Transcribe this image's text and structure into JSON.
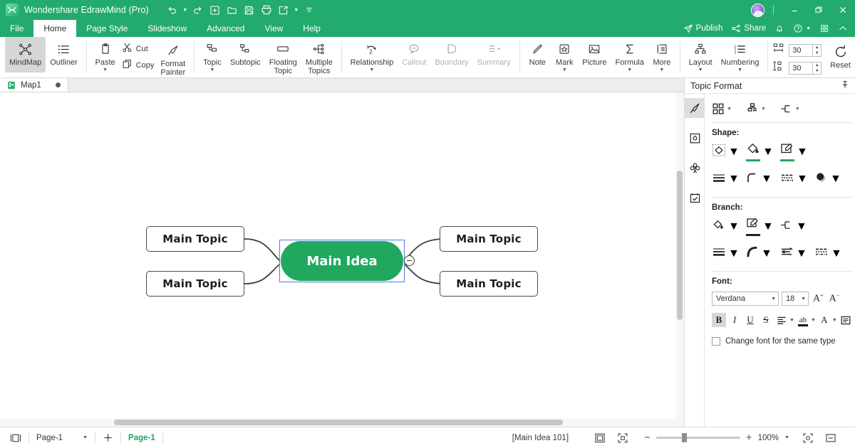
{
  "titlebar": {
    "app_name": "Wondershare EdrawMind (Pro)",
    "logo_glyph": "M",
    "quick_access": [
      {
        "name": "undo-icon",
        "label": "Undo",
        "caret": true
      },
      {
        "name": "redo-icon",
        "label": "Redo",
        "caret": false
      },
      {
        "name": "new-icon",
        "label": "New",
        "caret": false
      },
      {
        "name": "open-folder-icon",
        "label": "Open",
        "caret": false
      },
      {
        "name": "save-icon",
        "label": "Save",
        "caret": false
      },
      {
        "name": "print-icon",
        "label": "Print",
        "caret": false
      },
      {
        "name": "export-icon",
        "label": "Export",
        "caret": true
      },
      {
        "name": "more-quick-access-icon",
        "label": "More",
        "caret": false
      }
    ],
    "window_controls": [
      "minimize",
      "restore",
      "close"
    ]
  },
  "menubar": {
    "items": [
      {
        "label": "File",
        "active": false
      },
      {
        "label": "Home",
        "active": true
      },
      {
        "label": "Page Style",
        "active": false
      },
      {
        "label": "Slideshow",
        "active": false
      },
      {
        "label": "Advanced",
        "active": false
      },
      {
        "label": "View",
        "active": false
      },
      {
        "label": "Help",
        "active": false
      }
    ],
    "right": {
      "publish": "Publish",
      "share": "Share",
      "bell_icon": "notification-bell-icon",
      "help_icon": "help-circle-icon",
      "apps_icon": "apps-grid-icon",
      "collapse_icon": "collapse-ribbon-icon"
    }
  },
  "ribbon": {
    "view_group": [
      {
        "label": "MindMap",
        "icon": "mindmap-icon",
        "selected": true,
        "disabled": false
      },
      {
        "label": "Outliner",
        "icon": "outliner-icon",
        "selected": false,
        "disabled": false
      }
    ],
    "clipboard": {
      "paste": "Paste",
      "cut": "Cut",
      "copy": "Copy",
      "format_painter": "Format\nPainter"
    },
    "topic_group": [
      {
        "label": "Topic",
        "icon": "topic-icon",
        "caret": true
      },
      {
        "label": "Subtopic",
        "icon": "subtopic-icon",
        "caret": false
      },
      {
        "label": "Floating\nTopic",
        "icon": "floating-topic-icon",
        "caret": false
      },
      {
        "label": "Multiple\nTopics",
        "icon": "multiple-topics-icon",
        "caret": false
      }
    ],
    "relation_group": [
      {
        "label": "Relationship",
        "icon": "relationship-icon",
        "caret": true,
        "disabled": false
      },
      {
        "label": "Callout",
        "icon": "callout-icon",
        "caret": false,
        "disabled": true
      },
      {
        "label": "Boundary",
        "icon": "boundary-icon",
        "caret": false,
        "disabled": true
      },
      {
        "label": "Summary",
        "icon": "summary-icon",
        "caret": false,
        "disabled": true
      }
    ],
    "insert_group": [
      {
        "label": "Note",
        "icon": "note-icon",
        "caret": false
      },
      {
        "label": "Mark",
        "icon": "mark-icon",
        "caret": true
      },
      {
        "label": "Picture",
        "icon": "picture-icon",
        "caret": false
      },
      {
        "label": "Formula",
        "icon": "formula-icon",
        "caret": true
      },
      {
        "label": "More",
        "icon": "more-insert-icon",
        "caret": true
      }
    ],
    "layout_group": [
      {
        "label": "Layout",
        "icon": "layout-icon",
        "caret": true
      },
      {
        "label": "Numbering",
        "icon": "numbering-icon",
        "caret": true
      }
    ],
    "spacing": {
      "horizontal_icon": "horizontal-spacing-icon",
      "horizontal_value": "30",
      "vertical_icon": "vertical-spacing-icon",
      "vertical_value": "30",
      "reset_label": "Reset",
      "reset_icon": "reset-icon"
    }
  },
  "doc_tabs": [
    {
      "label": "Map1",
      "icon": "document-icon",
      "modified": true
    }
  ],
  "canvas": {
    "center_topic": "Main Idea",
    "branches": [
      {
        "label": "Main Topic",
        "position": "top-left"
      },
      {
        "label": "Main Topic",
        "position": "bottom-left"
      },
      {
        "label": "Main Topic",
        "position": "top-right"
      },
      {
        "label": "Main Topic",
        "position": "bottom-right"
      }
    ],
    "collapse_icon": "collapse-node-icon",
    "center_fill": "#21a85f",
    "selection_color": "#4a7fe0"
  },
  "right_panel": {
    "title": "Topic Format",
    "pin_icon": "pin-icon",
    "tabs": [
      {
        "name": "style-tab",
        "icon": "paint-brush-icon",
        "active": true
      },
      {
        "name": "image-tab",
        "icon": "image-frame-icon",
        "active": false
      },
      {
        "name": "clipart-tab",
        "icon": "clover-icon",
        "active": false
      },
      {
        "name": "task-tab",
        "icon": "task-checklist-icon",
        "active": false
      }
    ],
    "top_tools": [
      {
        "name": "theme-icon",
        "caret": true
      },
      {
        "name": "layout-structure-icon",
        "caret": true
      },
      {
        "name": "branch-style-icon",
        "caret": true
      }
    ],
    "shape": {
      "label": "Shape:",
      "tools": [
        {
          "name": "shape-select-icon",
          "caret": true,
          "accent": false
        },
        {
          "name": "fill-color-icon",
          "caret": true,
          "accent": true
        },
        {
          "name": "shape-outline-icon",
          "caret": true,
          "accent": true
        },
        {
          "name": "line-weight-icon",
          "caret": true,
          "accent": false
        },
        {
          "name": "corner-style-icon",
          "caret": true,
          "accent": false
        },
        {
          "name": "line-dash-icon",
          "caret": true,
          "accent": false
        },
        {
          "name": "shadow-icon",
          "caret": true,
          "accent": false
        }
      ]
    },
    "branch": {
      "label": "Branch:",
      "tools": [
        {
          "name": "branch-fill-icon",
          "caret": true,
          "accent": false
        },
        {
          "name": "branch-outline-icon",
          "caret": true,
          "accent": true
        },
        {
          "name": "branch-connector-icon",
          "caret": true,
          "accent": false
        },
        {
          "name": "branch-weight-icon",
          "caret": true,
          "accent": false
        },
        {
          "name": "branch-curve-icon",
          "caret": true,
          "accent": false
        },
        {
          "name": "branch-arrow-icon",
          "caret": true,
          "accent": false
        },
        {
          "name": "branch-dash-icon",
          "caret": true,
          "accent": false
        }
      ]
    },
    "font": {
      "label": "Font:",
      "family": "Verdana",
      "size": "18",
      "increase_icon": "increase-font-size-icon",
      "decrease_icon": "decrease-font-size-icon",
      "bold": "B",
      "italic": "I",
      "underline": "U",
      "strikethrough": "S",
      "align_icon": "text-align-icon",
      "highlight_icon": "text-highlight-icon",
      "color_icon": "font-color-icon",
      "text_box_icon": "text-box-icon",
      "bold_active": true,
      "checkbox_label": "Change font for the same type",
      "checkbox_checked": false
    }
  },
  "status_bar": {
    "view_icon": "page-view-icon",
    "page_select": "Page-1",
    "add_page_icon": "add-page-icon",
    "current_page": "Page-1",
    "selection_info": "[Main Idea 101]",
    "fit_page_icon": "fit-page-icon",
    "fit_window_icon": "fit-window-icon",
    "zoom_minus": "−",
    "zoom_plus": "+",
    "zoom_level": "100%",
    "focus_icon": "focus-mode-icon",
    "full_screen_icon": "full-screen-icon"
  }
}
